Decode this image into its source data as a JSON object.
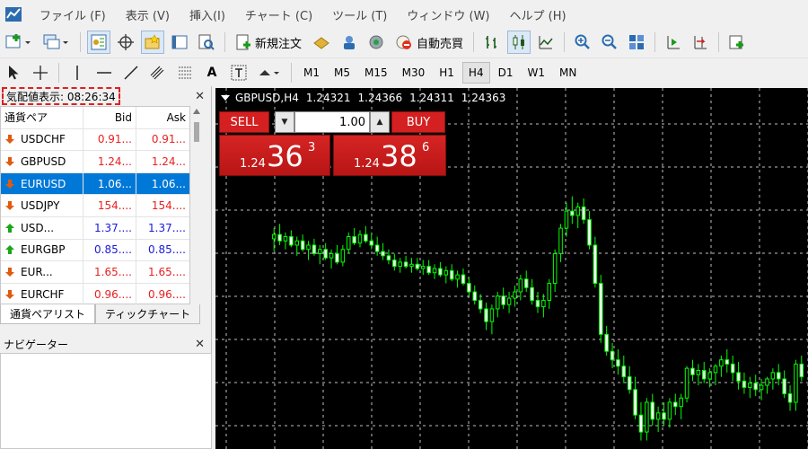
{
  "menu": [
    "ファイル (F)",
    "表示 (V)",
    "挿入(I)",
    "チャート (C)",
    "ツール (T)",
    "ウィンドウ (W)",
    "ヘルプ (H)"
  ],
  "toolbar": {
    "new_order": "新規注文",
    "auto_trading": "自動売買"
  },
  "drawing_tools": {
    "text_tool": "A"
  },
  "timeframes": [
    "M1",
    "M5",
    "M15",
    "M30",
    "H1",
    "H4",
    "D1",
    "W1",
    "MN"
  ],
  "active_timeframe": "H4",
  "market_watch": {
    "title": "気配値表示: 08:26:34",
    "columns": {
      "symbol": "通貨ペア",
      "bid": "Bid",
      "ask": "Ask"
    },
    "rows": [
      {
        "symbol": "USDCHF",
        "bid": "0.91...",
        "ask": "0.91...",
        "dir": "down"
      },
      {
        "symbol": "GBPUSD",
        "bid": "1.24...",
        "ask": "1.24...",
        "dir": "down"
      },
      {
        "symbol": "EURUSD",
        "bid": "1.06...",
        "ask": "1.06...",
        "dir": "down"
      },
      {
        "symbol": "USDJPY",
        "bid": "154....",
        "ask": "154....",
        "dir": "down"
      },
      {
        "symbol": "USD...",
        "bid": "1.37....",
        "ask": "1.37....",
        "dir": "up"
      },
      {
        "symbol": "EURGBP",
        "bid": "0.85....",
        "ask": "0.85....",
        "dir": "up"
      },
      {
        "symbol": "EUR...",
        "bid": "1.65....",
        "ask": "1.65....",
        "dir": "down"
      },
      {
        "symbol": "EURCHF",
        "bid": "0.96....",
        "ask": "0.96....",
        "dir": "down"
      }
    ],
    "selected_symbol": "EURUSD",
    "tabs": [
      "通貨ペアリスト",
      "ティックチャート"
    ],
    "active_tab": "通貨ペアリスト"
  },
  "navigator": {
    "title": "ナビゲーター"
  },
  "chart": {
    "symbol_tf": "GBPUSD,H4",
    "ohlc": [
      "1.24321",
      "1.24366",
      "1.24311",
      "1.24363"
    ],
    "one_click": {
      "sell_label": "SELL",
      "buy_label": "BUY",
      "lot": "1.00",
      "sell_price_prefix": "1.24",
      "sell_price_big": "36",
      "sell_price_sup": "3",
      "buy_price_prefix": "1.24",
      "buy_price_big": "38",
      "buy_price_sup": "6"
    },
    "colors": {
      "background": "#000000",
      "bull_body": "#000000",
      "bear_body": "#ffffff",
      "wick": "#00ff00",
      "grid": "#c0c0c0"
    },
    "candles": [
      [
        1.2449,
        1.2454,
        1.2443,
        1.2451
      ],
      [
        1.2451,
        1.2456,
        1.2446,
        1.2448
      ],
      [
        1.2448,
        1.2452,
        1.2444,
        1.245
      ],
      [
        1.245,
        1.2453,
        1.2445,
        1.2446
      ],
      [
        1.2446,
        1.245,
        1.2441,
        1.2448
      ],
      [
        1.2448,
        1.2451,
        1.2443,
        1.2444
      ],
      [
        1.2444,
        1.2448,
        1.2439,
        1.2446
      ],
      [
        1.2446,
        1.2449,
        1.2441,
        1.2442
      ],
      [
        1.2442,
        1.2446,
        1.2437,
        1.2444
      ],
      [
        1.2444,
        1.2447,
        1.2439,
        1.244
      ],
      [
        1.244,
        1.2444,
        1.2435,
        1.2442
      ],
      [
        1.2442,
        1.2446,
        1.2437,
        1.2438
      ],
      [
        1.2438,
        1.2446,
        1.2436,
        1.2444
      ],
      [
        1.2444,
        1.2452,
        1.2442,
        1.245
      ],
      [
        1.245,
        1.2454,
        1.2446,
        1.2447
      ],
      [
        1.2447,
        1.2453,
        1.2445,
        1.2451
      ],
      [
        1.2451,
        1.2455,
        1.2447,
        1.2448
      ],
      [
        1.2448,
        1.2452,
        1.2444,
        1.2446
      ],
      [
        1.2446,
        1.245,
        1.2441,
        1.2443
      ],
      [
        1.2443,
        1.2447,
        1.2439,
        1.2441
      ],
      [
        1.2441,
        1.2444,
        1.2437,
        1.2439
      ],
      [
        1.2439,
        1.2442,
        1.2434,
        1.2436
      ],
      [
        1.2436,
        1.244,
        1.2433,
        1.2438
      ],
      [
        1.2438,
        1.2441,
        1.2435,
        1.2436
      ],
      [
        1.2436,
        1.244,
        1.2433,
        1.2437
      ],
      [
        1.2437,
        1.244,
        1.2434,
        1.2435
      ],
      [
        1.2435,
        1.2439,
        1.2432,
        1.2436
      ],
      [
        1.2436,
        1.2439,
        1.2432,
        1.2433
      ],
      [
        1.2433,
        1.2437,
        1.243,
        1.2435
      ],
      [
        1.2435,
        1.2438,
        1.2431,
        1.2432
      ],
      [
        1.2432,
        1.2436,
        1.2428,
        1.2434
      ],
      [
        1.2434,
        1.2437,
        1.2429,
        1.243
      ],
      [
        1.243,
        1.2434,
        1.2426,
        1.2432
      ],
      [
        1.2432,
        1.2435,
        1.2427,
        1.2428
      ],
      [
        1.2428,
        1.2431,
        1.2422,
        1.2424
      ],
      [
        1.2424,
        1.2427,
        1.2418,
        1.242
      ],
      [
        1.242,
        1.2423,
        1.2414,
        1.2416
      ],
      [
        1.2416,
        1.2419,
        1.2406,
        1.241
      ],
      [
        1.241,
        1.2418,
        1.2404,
        1.2416
      ],
      [
        1.2416,
        1.2424,
        1.2412,
        1.2422
      ],
      [
        1.2422,
        1.2426,
        1.2416,
        1.2418
      ],
      [
        1.2418,
        1.2424,
        1.2414,
        1.2421
      ],
      [
        1.2421,
        1.2427,
        1.2417,
        1.2424
      ],
      [
        1.2424,
        1.2432,
        1.242,
        1.243
      ],
      [
        1.243,
        1.2434,
        1.2424,
        1.2426
      ],
      [
        1.2426,
        1.243,
        1.2418,
        1.242
      ],
      [
        1.242,
        1.2424,
        1.2414,
        1.2417
      ],
      [
        1.2417,
        1.2423,
        1.2412,
        1.242
      ],
      [
        1.242,
        1.243,
        1.2416,
        1.2428
      ],
      [
        1.2428,
        1.2444,
        1.2424,
        1.2442
      ],
      [
        1.2442,
        1.2456,
        1.2438,
        1.2454
      ],
      [
        1.2454,
        1.2466,
        1.245,
        1.2462
      ],
      [
        1.2462,
        1.2469,
        1.2456,
        1.246
      ],
      [
        1.246,
        1.2466,
        1.2454,
        1.2464
      ],
      [
        1.2464,
        1.2468,
        1.2456,
        1.2458
      ],
      [
        1.2458,
        1.2462,
        1.2444,
        1.2446
      ],
      [
        1.2446,
        1.245,
        1.2426,
        1.2428
      ],
      [
        1.2428,
        1.2432,
        1.24,
        1.2404
      ],
      [
        1.2404,
        1.2408,
        1.2394,
        1.2396
      ],
      [
        1.2396,
        1.24,
        1.2388,
        1.2392
      ],
      [
        1.2392,
        1.2397,
        1.2385,
        1.2389
      ],
      [
        1.2389,
        1.2394,
        1.2381,
        1.2384
      ],
      [
        1.2384,
        1.2389,
        1.2376,
        1.2378
      ],
      [
        1.2378,
        1.2384,
        1.2364,
        1.2366
      ],
      [
        1.2366,
        1.2372,
        1.2354,
        1.2358
      ],
      [
        1.2358,
        1.2374,
        1.2354,
        1.2372
      ],
      [
        1.2372,
        1.2376,
        1.2361,
        1.2364
      ],
      [
        1.2364,
        1.237,
        1.2358,
        1.2367
      ],
      [
        1.2367,
        1.2372,
        1.2361,
        1.2364
      ],
      [
        1.2364,
        1.2374,
        1.236,
        1.2372
      ],
      [
        1.2372,
        1.2376,
        1.2366,
        1.237
      ],
      [
        1.237,
        1.2376,
        1.2364,
        1.2374
      ],
      [
        1.2374,
        1.2389,
        1.2372,
        1.2388
      ],
      [
        1.2388,
        1.2392,
        1.2382,
        1.2385
      ],
      [
        1.2385,
        1.239,
        1.238,
        1.2387
      ],
      [
        1.2387,
        1.2391,
        1.2381,
        1.2383
      ],
      [
        1.2383,
        1.2388,
        1.2379,
        1.2386
      ],
      [
        1.2386,
        1.239,
        1.238,
        1.2389
      ],
      [
        1.2389,
        1.2394,
        1.2384,
        1.2392
      ],
      [
        1.2392,
        1.2397,
        1.2386,
        1.239
      ],
      [
        1.239,
        1.2394,
        1.2382,
        1.2386
      ],
      [
        1.2386,
        1.2391,
        1.2378,
        1.2382
      ],
      [
        1.2382,
        1.2386,
        1.2376,
        1.2379
      ],
      [
        1.2379,
        1.2384,
        1.2374,
        1.2381
      ],
      [
        1.2381,
        1.2385,
        1.2375,
        1.2378
      ],
      [
        1.2378,
        1.2383,
        1.2373,
        1.238
      ],
      [
        1.238,
        1.2384,
        1.2376,
        1.2383
      ],
      [
        1.2383,
        1.2388,
        1.2378,
        1.2386
      ],
      [
        1.2386,
        1.239,
        1.238,
        1.2383
      ],
      [
        1.2383,
        1.2387,
        1.2374,
        1.2376
      ],
      [
        1.2376,
        1.238,
        1.2368,
        1.2372
      ],
      [
        1.2372,
        1.2392,
        1.2368,
        1.239
      ],
      [
        1.239,
        1.2394,
        1.2382,
        1.2384
      ]
    ],
    "price_range": [
      1.235,
      1.252
    ]
  }
}
